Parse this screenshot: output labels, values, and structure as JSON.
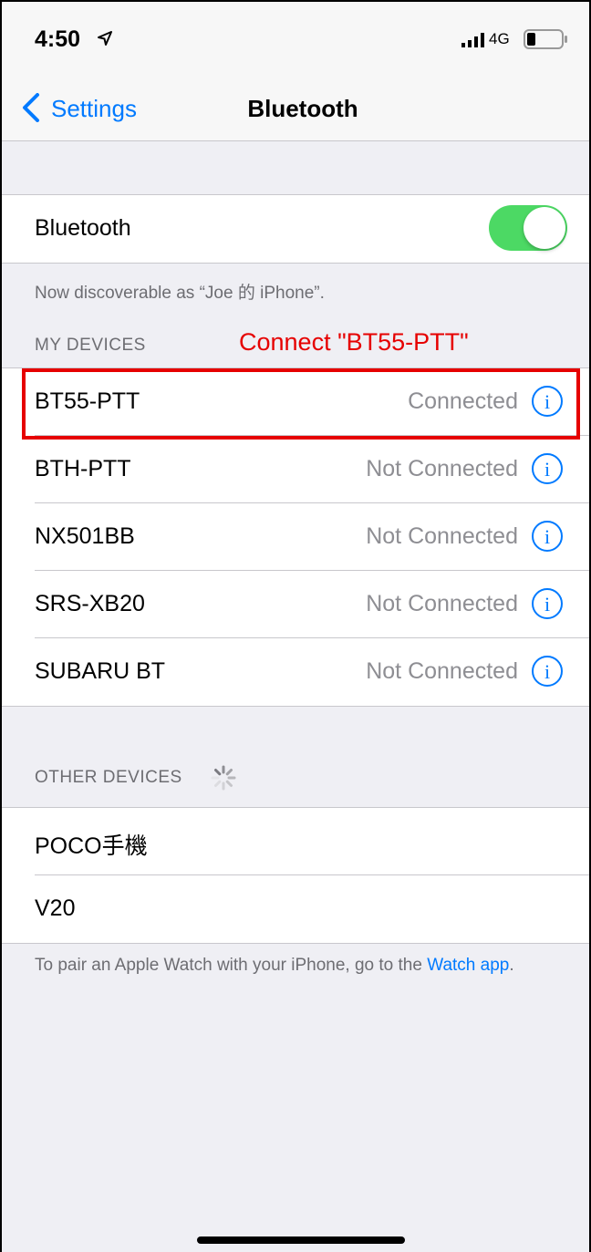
{
  "status_bar": {
    "time": "4:50",
    "network": "4G"
  },
  "nav": {
    "back_label": "Settings",
    "title": "Bluetooth"
  },
  "bluetooth_toggle": {
    "label": "Bluetooth",
    "on": true,
    "color": "#4cd964"
  },
  "discoverable_text": "Now discoverable as “Joe 的 iPhone”.",
  "my_devices": {
    "header": "MY DEVICES",
    "items": [
      {
        "name": "BT55-PTT",
        "status": "Connected"
      },
      {
        "name": "BTH-PTT",
        "status": "Not Connected"
      },
      {
        "name": "NX501BB",
        "status": "Not Connected"
      },
      {
        "name": "SRS-XB20",
        "status": "Not Connected"
      },
      {
        "name": "SUBARU BT",
        "status": "Not Connected"
      }
    ]
  },
  "annotation": {
    "text": "Connect \"BT55-PTT\"",
    "color": "#e60000"
  },
  "other_devices": {
    "header": "OTHER DEVICES",
    "items": [
      {
        "name": "POCO手機"
      },
      {
        "name": "V20"
      }
    ]
  },
  "pair_note": {
    "text": "To pair an Apple Watch with your iPhone, go to the ",
    "link": "Watch app",
    "suffix": "."
  },
  "colors": {
    "accent": "#007aff",
    "background": "#efeff4",
    "secondary_text": "#8e8e93"
  },
  "icons": {
    "back": "chevron-left-icon",
    "location": "location-arrow-icon",
    "signal": "cellular-signal-icon",
    "battery": "battery-icon",
    "info": "info-circle-icon",
    "spinner": "activity-spinner-icon"
  }
}
